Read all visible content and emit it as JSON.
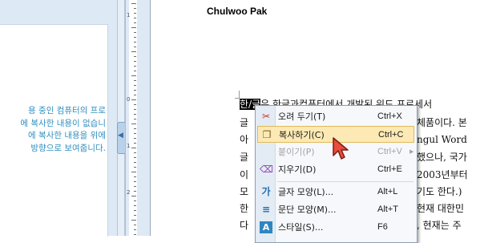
{
  "left_pane": {
    "lines": [
      "용 중인 컴퓨터의 프로",
      "에 복사한 내용이 없습니",
      "에 복사한 내용을 위에",
      "방향으로 보여줍니다."
    ]
  },
  "ruler": {
    "labels": [
      "1",
      "0",
      "1",
      "2"
    ]
  },
  "document": {
    "header": "Chulwoo Pak",
    "selected_text": "한/글",
    "lines": [
      "은 한글과컴퓨터에서 개발된 워드 프로세서",
      "체품이다. 본",
      "ngul Word",
      "했으나, 국가",
      "2003년부터",
      "기도 한다.)",
      "현재 대한민",
      ", 현재는 주"
    ]
  },
  "context_menu": {
    "items": [
      {
        "label": "오려 두기(T)",
        "shortcut": "Ctrl+X",
        "icon": "scissors-icon",
        "glyph": "✂"
      },
      {
        "label": "복사하기(C)",
        "shortcut": "Ctrl+C",
        "icon": "copy-icon",
        "glyph": "❐"
      },
      {
        "label": "붙이기(P)",
        "shortcut": "Ctrl+V",
        "icon": "paste-icon",
        "glyph": ""
      },
      {
        "label": "지우기(D)",
        "shortcut": "Ctrl+E",
        "icon": "eraser-icon",
        "glyph": "⌫"
      },
      {
        "label": "글자 모양(L)...",
        "shortcut": "Alt+L",
        "icon": "char-shape-icon",
        "glyph": "가"
      },
      {
        "label": "문단 모양(M)...",
        "shortcut": "Alt+T",
        "icon": "paragraph-shape-icon",
        "glyph": "≡"
      },
      {
        "label": "스타일(S)...",
        "shortcut": "F6",
        "icon": "style-icon",
        "glyph": "A"
      }
    ]
  },
  "colors": {
    "highlight": "#fce9b4",
    "selection": "#000000",
    "left_text": "#2f8fbf"
  }
}
